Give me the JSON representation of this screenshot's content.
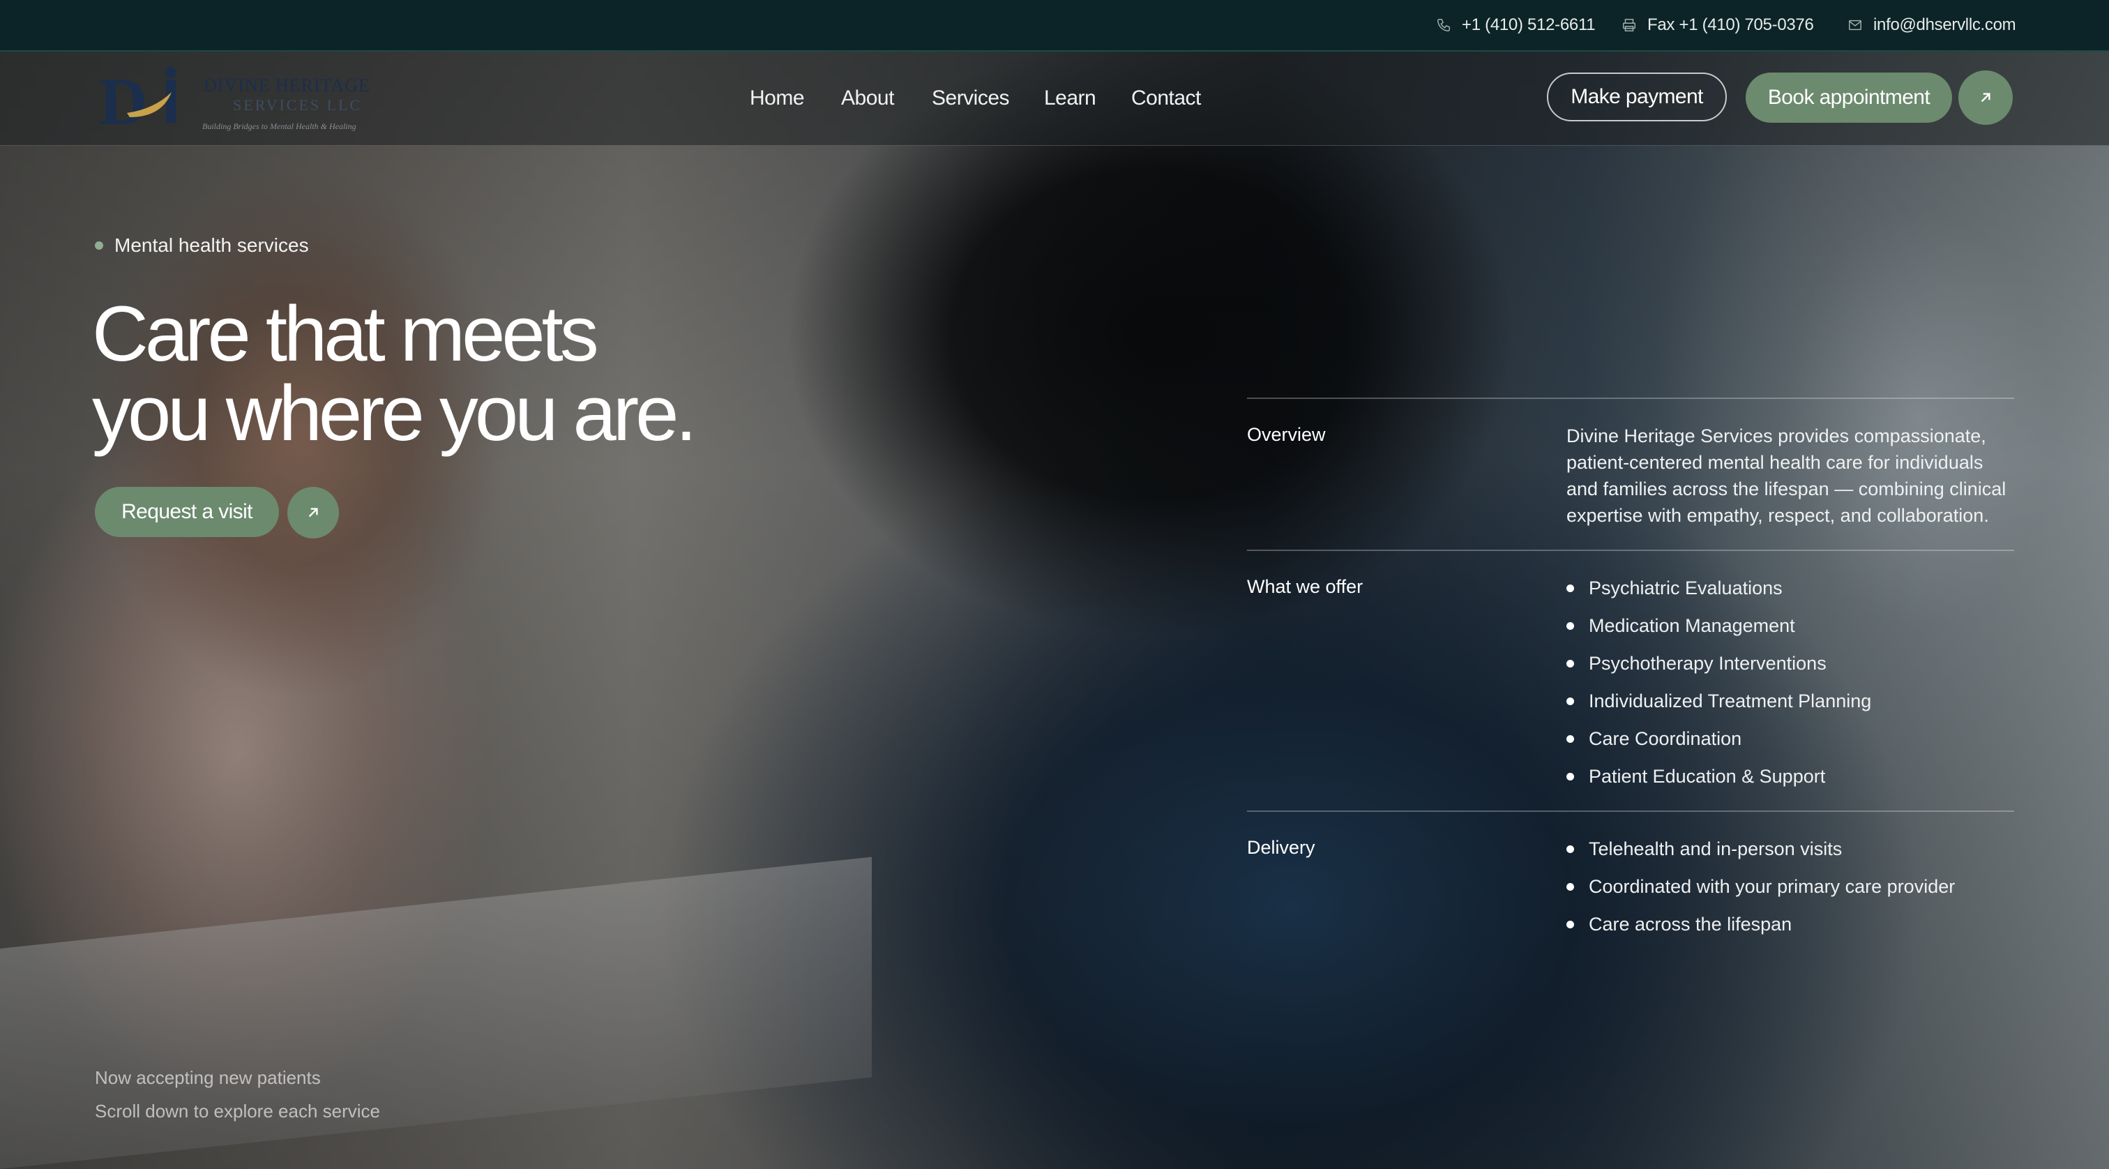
{
  "topbar": {
    "phone": "+1 (410) 512-6611",
    "fax": "Fax +1 (410) 705-0376",
    "email": "info@dhservllc.com",
    "icons": {
      "phone": "phone-icon",
      "fax": "printer-icon",
      "email": "mail-icon"
    }
  },
  "brand": {
    "line1": "DIVINE HERITAGE",
    "line2": "SERVICES LLC",
    "tagline": "Building Bridges to Mental Health & Healing"
  },
  "nav": {
    "items": [
      "Home",
      "About",
      "Services",
      "Learn",
      "Contact"
    ]
  },
  "actions": {
    "make_payment": "Make payment",
    "book_appointment": "Book appointment",
    "arrow_icon": "arrow-up-right-icon"
  },
  "hero": {
    "eyebrow": "Mental health services",
    "headline_line1": "Care that meets",
    "headline_line2": "you where you are.",
    "cta": "Request a visit",
    "footnote1": "Now accepting new patients",
    "footnote2": "Scroll down to explore each service"
  },
  "info": {
    "overview": {
      "label": "Overview",
      "text": "Divine Heritage Services provides compassionate, patient-centered mental health care for individuals and families across the lifespan — combining clinical expertise with empathy, respect, and collaboration."
    },
    "offer": {
      "label": "What we offer",
      "items": [
        "Psychiatric Evaluations",
        "Medication Management",
        "Psychotherapy Interventions",
        "Individualized Treatment Planning",
        "Care Coordination",
        "Patient Education & Support"
      ]
    },
    "delivery": {
      "label": "Delivery",
      "items": [
        "Telehealth and in-person visits",
        "Coordinated with your primary care provider",
        "Care across the lifespan"
      ]
    }
  },
  "colors": {
    "topbar": "#0c2428",
    "accent_green": "#6c8a6e",
    "logo_navy": "#1b2e4c",
    "logo_gold": "#c9a24a"
  }
}
